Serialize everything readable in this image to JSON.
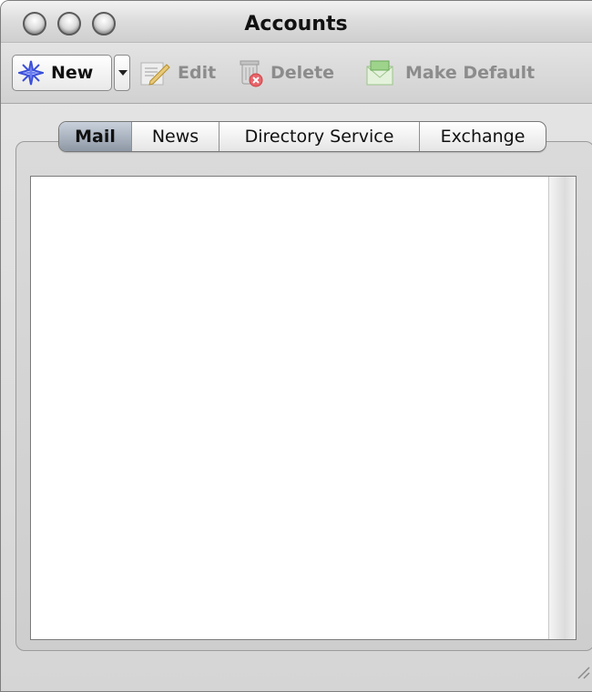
{
  "window": {
    "title": "Accounts"
  },
  "toolbar": {
    "new_label": "New",
    "edit_label": "Edit",
    "delete_label": "Delete",
    "make_default_label": "Make Default"
  },
  "tabs": [
    {
      "label": "Mail",
      "selected": true
    },
    {
      "label": "News",
      "selected": false
    },
    {
      "label": "Directory Service",
      "selected": false
    },
    {
      "label": "Exchange",
      "selected": false
    }
  ],
  "accounts": [],
  "colors": {
    "active_tab": "#8e98a5",
    "new_icon": "#3a4fd9",
    "disabled_text": "#8c8c8c"
  }
}
